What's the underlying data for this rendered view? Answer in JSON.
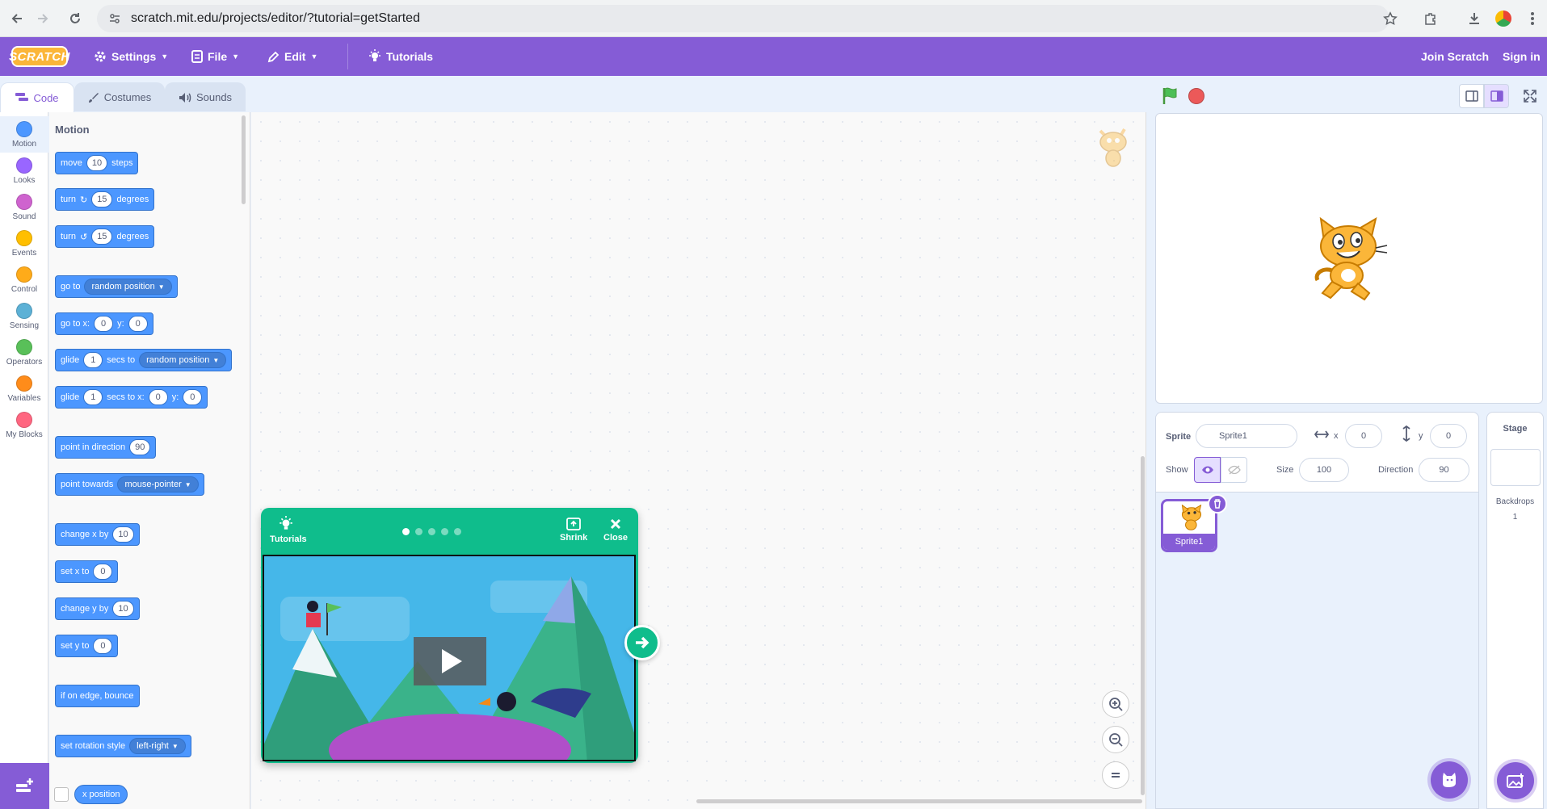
{
  "browser": {
    "url": "scratch.mit.edu/projects/editor/?tutorial=getStarted"
  },
  "menubar": {
    "logo": "SCRATCH",
    "settings": "Settings",
    "file": "File",
    "edit": "Edit",
    "tutorials": "Tutorials",
    "join": "Join Scratch",
    "sign_in": "Sign in"
  },
  "tabs": {
    "code": "Code",
    "costumes": "Costumes",
    "sounds": "Sounds"
  },
  "categories": [
    {
      "label": "Motion",
      "color": "#4c97ff"
    },
    {
      "label": "Looks",
      "color": "#9966ff"
    },
    {
      "label": "Sound",
      "color": "#cf63cf"
    },
    {
      "label": "Events",
      "color": "#ffbf00"
    },
    {
      "label": "Control",
      "color": "#ffab19"
    },
    {
      "label": "Sensing",
      "color": "#5cb1d6"
    },
    {
      "label": "Operators",
      "color": "#59c059"
    },
    {
      "label": "Variables",
      "color": "#ff8c1a"
    },
    {
      "label": "My Blocks",
      "color": "#ff6680"
    }
  ],
  "palette": {
    "title": "Motion",
    "move": {
      "a": "move",
      "n": "10",
      "b": "steps"
    },
    "turn_right": {
      "a": "turn",
      "n": "15",
      "b": "degrees"
    },
    "turn_left": {
      "a": "turn",
      "n": "15",
      "b": "degrees"
    },
    "goto": {
      "a": "go to",
      "d": "random position"
    },
    "gotoxy": {
      "a": "go to x:",
      "x": "0",
      "b": "y:",
      "y": "0"
    },
    "glide_to": {
      "a": "glide",
      "n": "1",
      "b": "secs to",
      "d": "random position"
    },
    "glide_xy": {
      "a": "glide",
      "n": "1",
      "b": "secs to x:",
      "x": "0",
      "c": "y:",
      "y": "0"
    },
    "point_dir": {
      "a": "point in direction",
      "n": "90"
    },
    "point_towards": {
      "a": "point towards",
      "d": "mouse-pointer"
    },
    "change_x": {
      "a": "change x by",
      "n": "10"
    },
    "set_x": {
      "a": "set x to",
      "n": "0"
    },
    "change_y": {
      "a": "change y by",
      "n": "10"
    },
    "set_y": {
      "a": "set y to",
      "n": "0"
    },
    "bounce": "if on edge, bounce",
    "rotation": {
      "a": "set rotation style",
      "d": "left-right"
    },
    "x_position": "x position"
  },
  "tutorial": {
    "label": "Tutorials",
    "shrink": "Shrink",
    "close": "Close",
    "step_count": 5,
    "active_step": 1
  },
  "sprite_info": {
    "sprite_label": "Sprite",
    "sprite_name": "Sprite1",
    "x_label": "x",
    "x": "0",
    "y_label": "y",
    "y": "0",
    "show_label": "Show",
    "size_label": "Size",
    "size": "100",
    "direction_label": "Direction",
    "direction": "90"
  },
  "sprites": [
    {
      "name": "Sprite1",
      "selected": true
    }
  ],
  "stage_panel": {
    "title": "Stage",
    "backdrops_label": "Backdrops",
    "backdrops_count": "1"
  },
  "colors": {
    "menubar": "#855cd6",
    "motion": "#4c97ff",
    "tutorial": "#0fbd8c"
  }
}
